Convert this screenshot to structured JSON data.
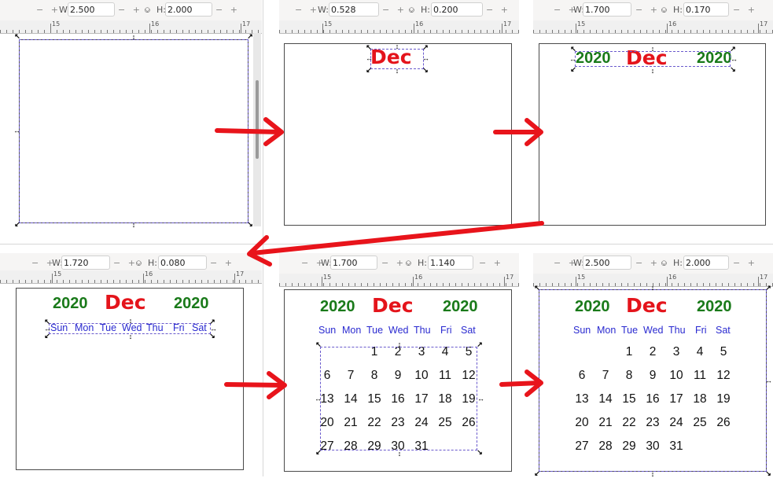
{
  "panels": [
    {
      "w_label": "W:",
      "w_value": "2.500",
      "h_label": "H:",
      "h_value": "2.000",
      "plus_minus": "− +",
      "lock": "ก",
      "ruler_a": "15",
      "ruler_b": "16",
      "ruler_c": "17"
    },
    {
      "w_label": "W:",
      "w_value": "0.528",
      "h_label": "H:",
      "h_value": "0.200",
      "plus_minus": "− +",
      "lock": "ก",
      "ruler_a": "15",
      "ruler_b": "16",
      "ruler_c": "17"
    },
    {
      "w_label": "W:",
      "w_value": "1.700",
      "h_label": "H:",
      "h_value": "0.170",
      "plus_minus": "− +",
      "lock": "ก",
      "ruler_a": "15",
      "ruler_b": "16",
      "ruler_c": "17"
    },
    {
      "w_label": "W:",
      "w_value": "1.720",
      "h_label": "H:",
      "h_value": "0.080",
      "plus_minus": "− +",
      "lock": "ก",
      "ruler_a": "15",
      "ruler_b": "16",
      "ruler_c": "17"
    },
    {
      "w_label": "W:",
      "w_value": "1.700",
      "h_label": "H:",
      "h_value": "1.140",
      "plus_minus": "− +",
      "lock": "ก",
      "ruler_a": "15",
      "ruler_b": "16",
      "ruler_c": "17"
    },
    {
      "w_label": "W:",
      "w_value": "2.500",
      "h_label": "H:",
      "h_value": "2.000",
      "plus_minus": "− +",
      "lock": "ก",
      "ruler_a": "15",
      "ruler_b": "16",
      "ruler_c": "17"
    }
  ],
  "calendar": {
    "year": "2020",
    "month": "Dec",
    "weekdays": [
      "Sun",
      "Mon",
      "Tue",
      "Wed",
      "Thu",
      "Fri",
      "Sat"
    ],
    "weeks": [
      [
        "",
        "",
        "1",
        "2",
        "3",
        "4",
        "5"
      ],
      [
        "6",
        "7",
        "8",
        "9",
        "10",
        "11",
        "12"
      ],
      [
        "13",
        "14",
        "15",
        "16",
        "17",
        "18",
        "19"
      ],
      [
        "20",
        "21",
        "22",
        "23",
        "24",
        "25",
        "26"
      ],
      [
        "27",
        "28",
        "29",
        "30",
        "31",
        "",
        ""
      ]
    ]
  },
  "colors": {
    "year": "#1a7a1a",
    "month": "#e4141b",
    "weekdays": "#2a2ad0",
    "arrow": "#e8141b",
    "selection": "#6a5acd"
  },
  "icons": {
    "lock": "lock-icon",
    "arrow": "arrow-right-icon",
    "handle": "resize-handle-icon"
  }
}
